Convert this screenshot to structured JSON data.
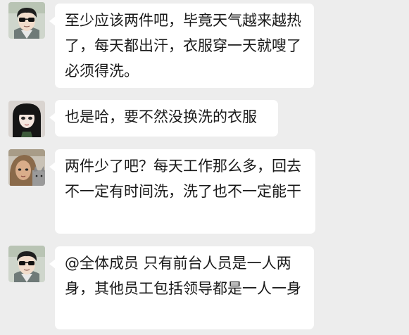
{
  "messages": [
    {
      "avatar": "male-sunglasses-avatar",
      "text": "至少应该两件吧，毕竟天气越来越热了，每天都出汗，衣服穿一天就嗖了必须得洗。"
    },
    {
      "avatar": "female-long-hair-avatar",
      "text": "也是哈，要不然没换洗的衣服"
    },
    {
      "avatar": "female-cat-avatar",
      "text": "两件少了吧？每天工作那么多，回去不一定有时间洗，洗了也不一定能干"
    },
    {
      "avatar": "male-sunglasses-avatar",
      "text": "@全体成员 只有前台人员是一人两身，其他员工包括领导都是一人一身"
    }
  ],
  "colors": {
    "background": "#ededed",
    "bubble": "#ffffff",
    "text": "#1a1a1a"
  }
}
